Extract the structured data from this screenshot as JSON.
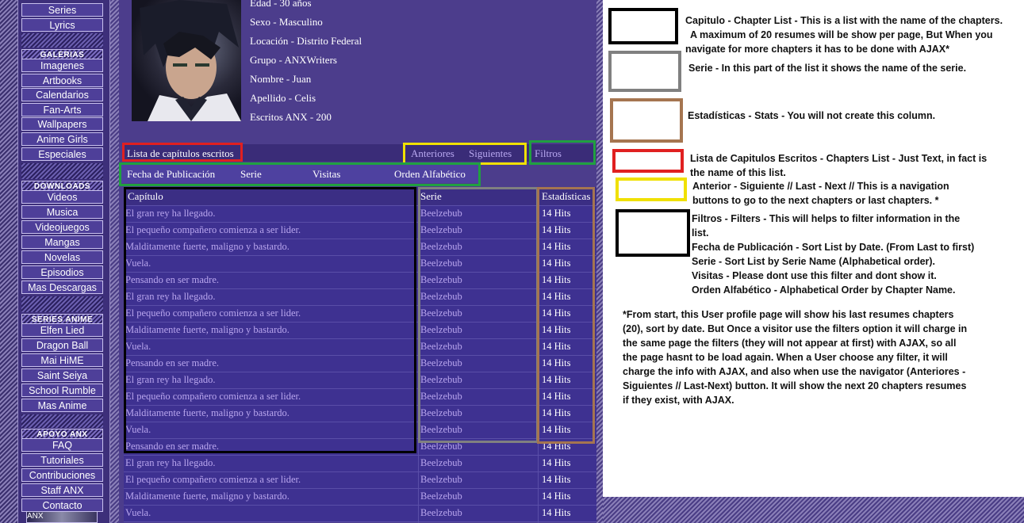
{
  "sidebar": {
    "top_items": [
      "Series",
      "Lyrics"
    ],
    "galerias": {
      "header": "GALERIAS",
      "items": [
        "Imagenes",
        "Artbooks",
        "Calendarios",
        "Fan-Arts",
        "Wallpapers",
        "Anime Girls",
        "Especiales"
      ]
    },
    "downloads": {
      "header": "DOWNLOADS",
      "items": [
        "Videos",
        "Musica",
        "Videojuegos",
        "Mangas",
        "Novelas",
        "Episodios",
        "Mas Descargas"
      ]
    },
    "series_anime": {
      "header": "SERIES ANIME",
      "items": [
        "Elfen Lied",
        "Dragon Ball",
        "Mai HiME",
        "Saint Seiya",
        "School Rumble",
        "Mas Anime"
      ]
    },
    "apoyo": {
      "header": "APOYO ANX",
      "items": [
        "FAQ",
        "Tutoriales",
        "Contribuciones",
        "Staff ANX",
        "Contacto"
      ]
    },
    "bottom_badge": "ANX"
  },
  "profile": {
    "fields": [
      "Edad - 30 años",
      "Sexo - Masculino",
      "Locación - Distrito Federal",
      "Grupo - ANXWriters",
      "Nombre - Juan",
      "Apellido - Celis",
      "Escritos ANX - 200"
    ]
  },
  "list": {
    "title": "Lista de capítulos escritos",
    "prev_label": "Anteriores",
    "next_label": "Siguientes",
    "filters_label": "Filtros",
    "filters": [
      "Fecha de Publicación",
      "Serie",
      "Visitas",
      "Orden Alfabético"
    ],
    "columns": [
      "Capítulo",
      "Serie",
      "Estadísticas"
    ],
    "rows": [
      [
        "El gran rey ha llegado.",
        "Beelzebub",
        "14 Hits"
      ],
      [
        "El pequeño compañero comienza a ser lider.",
        "Beelzebub",
        "14 Hits"
      ],
      [
        "Malditamente fuerte, maligno y bastardo.",
        "Beelzebub",
        "14 Hits"
      ],
      [
        "Vuela.",
        "Beelzebub",
        "14 Hits"
      ],
      [
        "Pensando en ser madre.",
        "Beelzebub",
        "14 Hits"
      ],
      [
        "El gran rey ha llegado.",
        "Beelzebub",
        "14 Hits"
      ],
      [
        "El pequeño compañero comienza a ser lider.",
        "Beelzebub",
        "14 Hits"
      ],
      [
        "Malditamente fuerte, maligno y bastardo.",
        "Beelzebub",
        "14 Hits"
      ],
      [
        "Vuela.",
        "Beelzebub",
        "14 Hits"
      ],
      [
        "Pensando en ser madre.",
        "Beelzebub",
        "14 Hits"
      ],
      [
        "El gran rey ha llegado.",
        "Beelzebub",
        "14 Hits"
      ],
      [
        "El pequeño compañero comienza a ser lider.",
        "Beelzebub",
        "14 Hits"
      ],
      [
        "Malditamente fuerte, maligno y bastardo.",
        "Beelzebub",
        "14 Hits"
      ],
      [
        "Vuela.",
        "Beelzebub",
        "14 Hits"
      ],
      [
        "Pensando en ser madre.",
        "Beelzebub",
        "14 Hits"
      ],
      [
        "El gran rey ha llegado.",
        "Beelzebub",
        "14 Hits"
      ],
      [
        "El pequeño compañero comienza a ser lider.",
        "Beelzebub",
        "14 Hits"
      ],
      [
        "Malditamente fuerte, maligno y bastardo.",
        "Beelzebub",
        "14 Hits"
      ],
      [
        "Vuela.",
        "Beelzebub",
        "14 Hits"
      ]
    ]
  },
  "annotations": {
    "capitulo": [
      "Capitulo - Chapter List - This is a list with the name of the chapters.",
      "A maximum of 20 resumes will be show per page, But When you",
      "navigate for more chapters it has to be done with AJAX*"
    ],
    "serie": [
      "Serie - In this part of the list it shows the name of the serie."
    ],
    "estadisticas": [
      "Estadísticas - Stats - You will not create this column."
    ],
    "lista": [
      "Lista de Capitulos Escritos - Chapters List - Just Text, in fact is",
      "the name of this list."
    ],
    "anterior": [
      "Anterior - Siguiente // Last - Next // This is a navigation",
      "buttons to go to the next chapters or last chapters. *"
    ],
    "filtros": [
      "Filtros - Filters - This will helps to filter information in the",
      "list.",
      "Fecha de Publicación - Sort List by Date. (From Last to first)",
      "Serie - Sort List by Serie Name (Alphabetical order).",
      "Visitas - Please dont use this filter and dont show it.",
      "Orden Alfabético - Alphabetical Order by Chapter Name."
    ],
    "footnote": [
      "*From start, this User profile page will show his last resumes chapters",
      "(20), sort by date. But Once a visitor use the filters option it will charge in",
      "the same page the filters (they will not appear at first) with AJAX, so all",
      "the page hasnt to be load again. When a User choose any filter, it will",
      "charge the info with AJAX, and also when use the navigator (Anteriores -",
      "Siguientes // Last-Next) button. It will show the next 20 chapters resumes",
      "if they exist, with AJAX."
    ]
  },
  "colors": {
    "capitulo_box": "#000000",
    "serie_box": "#808080",
    "estadisticas_box": "#a57550",
    "lista_box": "#e02020",
    "nav_box": "#f0e000",
    "filtros_box": "#20a040"
  }
}
